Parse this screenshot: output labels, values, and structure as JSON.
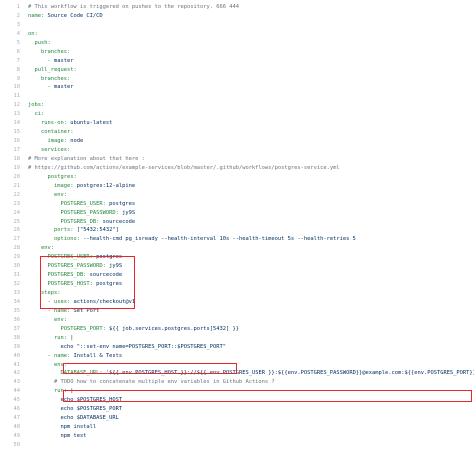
{
  "file": {
    "lines": [
      {
        "n": "1",
        "indent": "",
        "key": "",
        "value": "",
        "comment": "# This workflow is triggered on pushes to the repository. 666 444"
      },
      {
        "n": "2",
        "indent": "",
        "key": "name:",
        "value": " Source Code CI/CD",
        "comment": ""
      },
      {
        "n": "3",
        "indent": "",
        "key": "",
        "value": "",
        "comment": ""
      },
      {
        "n": "4",
        "indent": "",
        "key": "on:",
        "value": "",
        "comment": ""
      },
      {
        "n": "5",
        "indent": "  ",
        "key": "push:",
        "value": "",
        "comment": ""
      },
      {
        "n": "6",
        "indent": "    ",
        "key": "branches:",
        "value": "",
        "comment": ""
      },
      {
        "n": "7",
        "indent": "      ",
        "key": "- ",
        "value": "master",
        "comment": ""
      },
      {
        "n": "8",
        "indent": "  ",
        "key": "pull_request:",
        "value": "",
        "comment": ""
      },
      {
        "n": "9",
        "indent": "    ",
        "key": "branches:",
        "value": "",
        "comment": ""
      },
      {
        "n": "10",
        "indent": "      ",
        "key": "- ",
        "value": "master",
        "comment": ""
      },
      {
        "n": "11",
        "indent": "",
        "key": "",
        "value": "",
        "comment": ""
      },
      {
        "n": "12",
        "indent": "",
        "key": "jobs:",
        "value": "",
        "comment": ""
      },
      {
        "n": "13",
        "indent": "  ",
        "key": "ci:",
        "value": "",
        "comment": ""
      },
      {
        "n": "14",
        "indent": "    ",
        "key": "runs-on:",
        "value": " ubuntu-latest",
        "comment": ""
      },
      {
        "n": "15",
        "indent": "    ",
        "key": "container:",
        "value": "",
        "comment": ""
      },
      {
        "n": "16",
        "indent": "      ",
        "key": "image:",
        "value": " node",
        "comment": ""
      },
      {
        "n": "17",
        "indent": "    ",
        "key": "services:",
        "value": "",
        "comment": ""
      },
      {
        "n": "18",
        "indent": "",
        "key": "",
        "value": "",
        "comment": "# More explanation about that here :"
      },
      {
        "n": "19",
        "indent": "",
        "key": "",
        "value": "",
        "comment": "# https://github.com/actions/example-services/blob/master/.github/workflows/postgres-service.yml"
      },
      {
        "n": "20",
        "indent": "      ",
        "key": "postgres:",
        "value": "",
        "comment": ""
      },
      {
        "n": "21",
        "indent": "        ",
        "key": "image:",
        "value": " postgres:12-alpine",
        "comment": ""
      },
      {
        "n": "22",
        "indent": "        ",
        "key": "env:",
        "value": "",
        "comment": ""
      },
      {
        "n": "23",
        "indent": "          ",
        "key": "POSTGRES_USER:",
        "value": " postgres",
        "comment": ""
      },
      {
        "n": "24",
        "indent": "          ",
        "key": "POSTGRES_PASSWORD:",
        "value": " jy9S",
        "comment": ""
      },
      {
        "n": "25",
        "indent": "          ",
        "key": "POSTGRES_DB:",
        "value": " sourcecode",
        "comment": ""
      },
      {
        "n": "26",
        "indent": "        ",
        "key": "ports:",
        "value": " [\"5432:5432\"]",
        "comment": ""
      },
      {
        "n": "27",
        "indent": "        ",
        "key": "options:",
        "value": " --health-cmd pg_isready --health-interval 10s --health-timeout 5s --health-retries 5",
        "comment": ""
      },
      {
        "n": "28",
        "indent": "    ",
        "key": "env:",
        "value": "",
        "comment": ""
      },
      {
        "n": "29",
        "indent": "      ",
        "key": "POSTGRES_USER:",
        "value": " postgres",
        "comment": ""
      },
      {
        "n": "30",
        "indent": "      ",
        "key": "POSTGRES_PASSWORD:",
        "value": " jy9S",
        "comment": ""
      },
      {
        "n": "31",
        "indent": "      ",
        "key": "POSTGRES_DB:",
        "value": " sourcecode",
        "comment": ""
      },
      {
        "n": "32",
        "indent": "      ",
        "key": "POSTGRES_HOST:",
        "value": " postgres",
        "comment": ""
      },
      {
        "n": "33",
        "indent": "    ",
        "key": "steps:",
        "value": "",
        "comment": ""
      },
      {
        "n": "34",
        "indent": "      ",
        "key": "- uses:",
        "value": " actions/checkout@v1",
        "comment": ""
      },
      {
        "n": "35",
        "indent": "      ",
        "key": "- name:",
        "value": " Set Port",
        "comment": ""
      },
      {
        "n": "36",
        "indent": "        ",
        "key": "env:",
        "value": "",
        "comment": ""
      },
      {
        "n": "37",
        "indent": "          ",
        "key": "POSTGRES_PORT:",
        "value": " ${{ job.services.postgres.ports[5432] }}",
        "comment": ""
      },
      {
        "n": "38",
        "indent": "        ",
        "key": "run:",
        "value": " |",
        "comment": ""
      },
      {
        "n": "39",
        "indent": "          ",
        "key": "",
        "value": "echo \"::set-env name=POSTGRES_PORT::$POSTGRES_PORT\"",
        "comment": ""
      },
      {
        "n": "40",
        "indent": "      ",
        "key": "- name:",
        "value": " Install & Tests",
        "comment": ""
      },
      {
        "n": "41",
        "indent": "        ",
        "key": "env:",
        "value": "",
        "comment": ""
      },
      {
        "n": "42",
        "indent": "          ",
        "key": "DATABASE_URL:",
        "value": " '${{ env.POSTGRES_HOST }}://${{ env.POSTGRES_USER }}:${{env.POSTGRES_PASSWORD}}@example.com:${{env.POSTGRES_PORT}}'",
        "comment": ""
      },
      {
        "n": "43",
        "indent": "        ",
        "key": "",
        "value": "",
        "comment": "# TODO how to concatenate multiple env variables in Github Actions ?"
      },
      {
        "n": "44",
        "indent": "        ",
        "key": "run:",
        "value": " |",
        "comment": ""
      },
      {
        "n": "45",
        "indent": "          ",
        "key": "",
        "value": "echo $POSTGRES_HOST",
        "comment": ""
      },
      {
        "n": "46",
        "indent": "          ",
        "key": "",
        "value": "echo $POSTGRES_PORT",
        "comment": ""
      },
      {
        "n": "47",
        "indent": "          ",
        "key": "",
        "value": "echo $DATABASE_URL",
        "comment": ""
      },
      {
        "n": "48",
        "indent": "          ",
        "key": "",
        "value": "npm install",
        "comment": ""
      },
      {
        "n": "49",
        "indent": "          ",
        "key": "",
        "value": "npm test",
        "comment": ""
      },
      {
        "n": "50",
        "indent": "",
        "key": "",
        "value": "",
        "comment": ""
      }
    ]
  },
  "colors": {
    "keyword": "#22863a",
    "string": "#032f62",
    "comment": "#6a737d",
    "line_number": "#aab0b6",
    "highlight_border": "#e5262b"
  }
}
